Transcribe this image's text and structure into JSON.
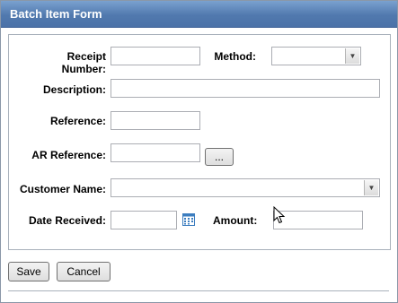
{
  "window": {
    "title": "Batch Item Form"
  },
  "form": {
    "receipt_number": {
      "label": "Receipt Number:",
      "value": ""
    },
    "method": {
      "label": "Method:",
      "selected": ""
    },
    "description": {
      "label": "Description:",
      "value": ""
    },
    "reference": {
      "label": "Reference:",
      "value": ""
    },
    "ar_reference": {
      "label": "AR Reference:",
      "value": "",
      "browse_label": "..."
    },
    "customer_name": {
      "label": "Customer Name:",
      "selected": ""
    },
    "date_received": {
      "label": "Date Received:",
      "value": ""
    },
    "amount": {
      "label": "Amount:",
      "value": ""
    }
  },
  "icons": {
    "dropdown": "chevron-down-icon",
    "calendar": "calendar-icon",
    "cursor": "mouse-pointer-icon"
  },
  "buttons": {
    "save": "Save",
    "cancel": "Cancel"
  },
  "colors": {
    "titlebar": "#5179ae",
    "title_text": "#ffffff",
    "calendar_icon": "#3c7dbf"
  }
}
